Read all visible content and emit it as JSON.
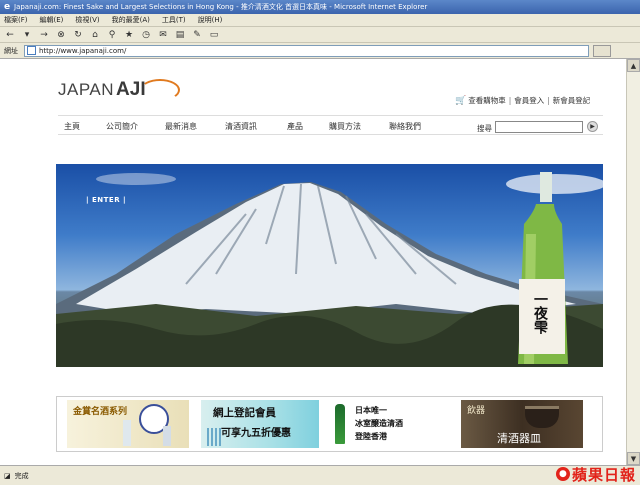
{
  "window": {
    "title": "Japanaji.com: Finest Sake and Largest Selections in Hong Kong - 推介清酒文化 首選日本真味 - Microsoft Internet Explorer"
  },
  "menu": {
    "items": [
      "檔案(F)",
      "編輯(E)",
      "檢視(V)",
      "我的最愛(A)",
      "工具(T)",
      "說明(H)"
    ]
  },
  "address": {
    "label": "網址",
    "url": "http://www.japanaji.com/"
  },
  "status": {
    "text": "完成"
  },
  "watermark": {
    "text": "蘋果日報"
  },
  "site": {
    "logo_part1": "JAPAN",
    "logo_part2": "AJI",
    "toplinks": {
      "cart": "查看購物車",
      "login": "會員登入",
      "register": "新會員登記"
    },
    "nav": [
      "主頁",
      "公司簡介",
      "最新消息",
      "清酒資訊",
      "產品",
      "購買方法",
      "聯絡我們"
    ],
    "search_label": "搜尋",
    "hero": {
      "enter": "| ENTER |",
      "bottle_label": "一夜雫"
    },
    "banners": {
      "b1": "金賞名酒系列",
      "b2_line1": "網上登記會員",
      "b2_line2": "可享九五折優惠",
      "b3_lines": [
        "日本唯一",
        "冰室醸造清酒",
        "登陸香港"
      ],
      "b4_top": "飲器",
      "b4_main": "清酒器皿"
    }
  },
  "colors": {
    "accent_orange": "#e07a1f",
    "titlebar_blue": "#3b64ad",
    "watermark_red": "#e2231a"
  }
}
